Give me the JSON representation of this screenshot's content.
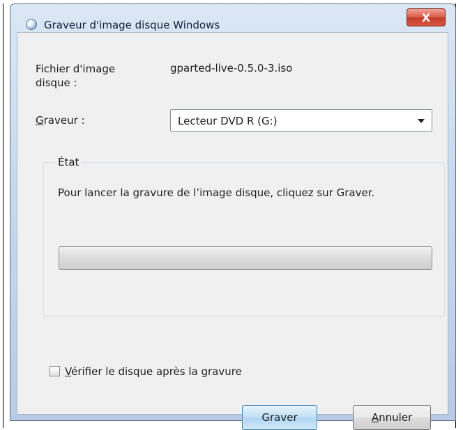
{
  "window": {
    "title": "Graveur d'image disque Windows",
    "close_glyph": "X"
  },
  "fields": {
    "image_label": "Fichier d'image disque :",
    "image_value": "gparted-live-0.5.0-3.iso",
    "burner_label": "Graveur :",
    "burner_value": "Lecteur DVD R (G:)"
  },
  "status": {
    "group_label": "État",
    "message": "Pour lancer la gravure de l’image disque, cliquez sur Graver.",
    "progress": 0
  },
  "options": {
    "verify_label": "Vérifier le disque après la gravure",
    "verify_checked": false
  },
  "buttons": {
    "burn_label": "Graver",
    "cancel_label": "Annuler"
  },
  "icons": {
    "app": "disc-burner-icon",
    "close": "close-icon",
    "dropdown": "chevron-down-icon"
  },
  "colors": {
    "titlebar": "#c8d9ee",
    "client": "#f0f0f0",
    "close_button": "#d95a4a",
    "primary_button": "#c1e0f5"
  }
}
